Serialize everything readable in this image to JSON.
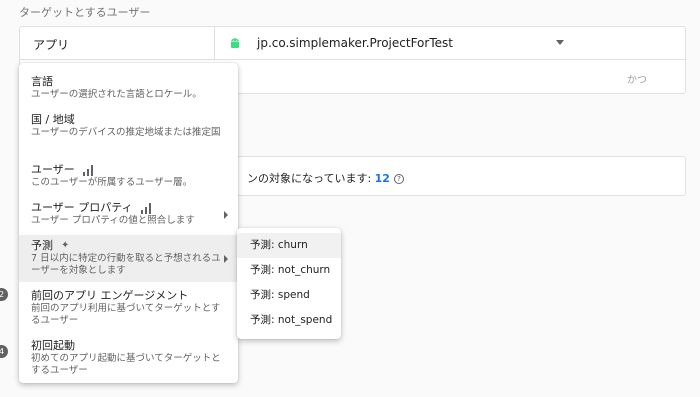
{
  "section_title": "ターゲットとするユーザー",
  "target": {
    "app_label": "アプリ",
    "app_id": "jp.co.simplemaker.ProjectForTest",
    "and_label": "かつ"
  },
  "info": {
    "text": "ンの対象になっています: ",
    "count": "12",
    "help_glyph": "?"
  },
  "side_dots": [
    "2",
    "4"
  ],
  "menu": {
    "items": [
      {
        "title": "言語",
        "desc": "ユーザーの選択された言語とロケール。"
      },
      {
        "title": "国 / 地域",
        "desc": "ユーザーのデバイスの推定地域または推定国"
      },
      {
        "title": "ユーザー",
        "desc": "このユーザーが所属するユーザー層。",
        "icon": "bar-chart-icon"
      },
      {
        "title": "ユーザー プロパティ",
        "desc": "ユーザー プロパティの値と照合します",
        "icon": "bar-chart-icon",
        "has_submenu": true
      },
      {
        "title": "予測",
        "desc": "7 日以内に特定の行動を取ると予想されるユーザーを対象とします",
        "icon": "magic-wand-icon",
        "has_submenu": true,
        "active": true
      },
      {
        "title": "前回のアプリ エンゲージメント",
        "desc": "前回のアプリ利用に基づいてターゲットとするユーザー"
      },
      {
        "title": "初回起動",
        "desc": "初めてのアプリ起動に基づいてターゲットとするユーザー"
      }
    ]
  },
  "submenu": {
    "items": [
      "予測: churn",
      "予測: not_churn",
      "予測: spend",
      "予測: not_spend"
    ]
  },
  "colors": {
    "accent": "#1a73e8",
    "android_green": "#3ddc84"
  }
}
